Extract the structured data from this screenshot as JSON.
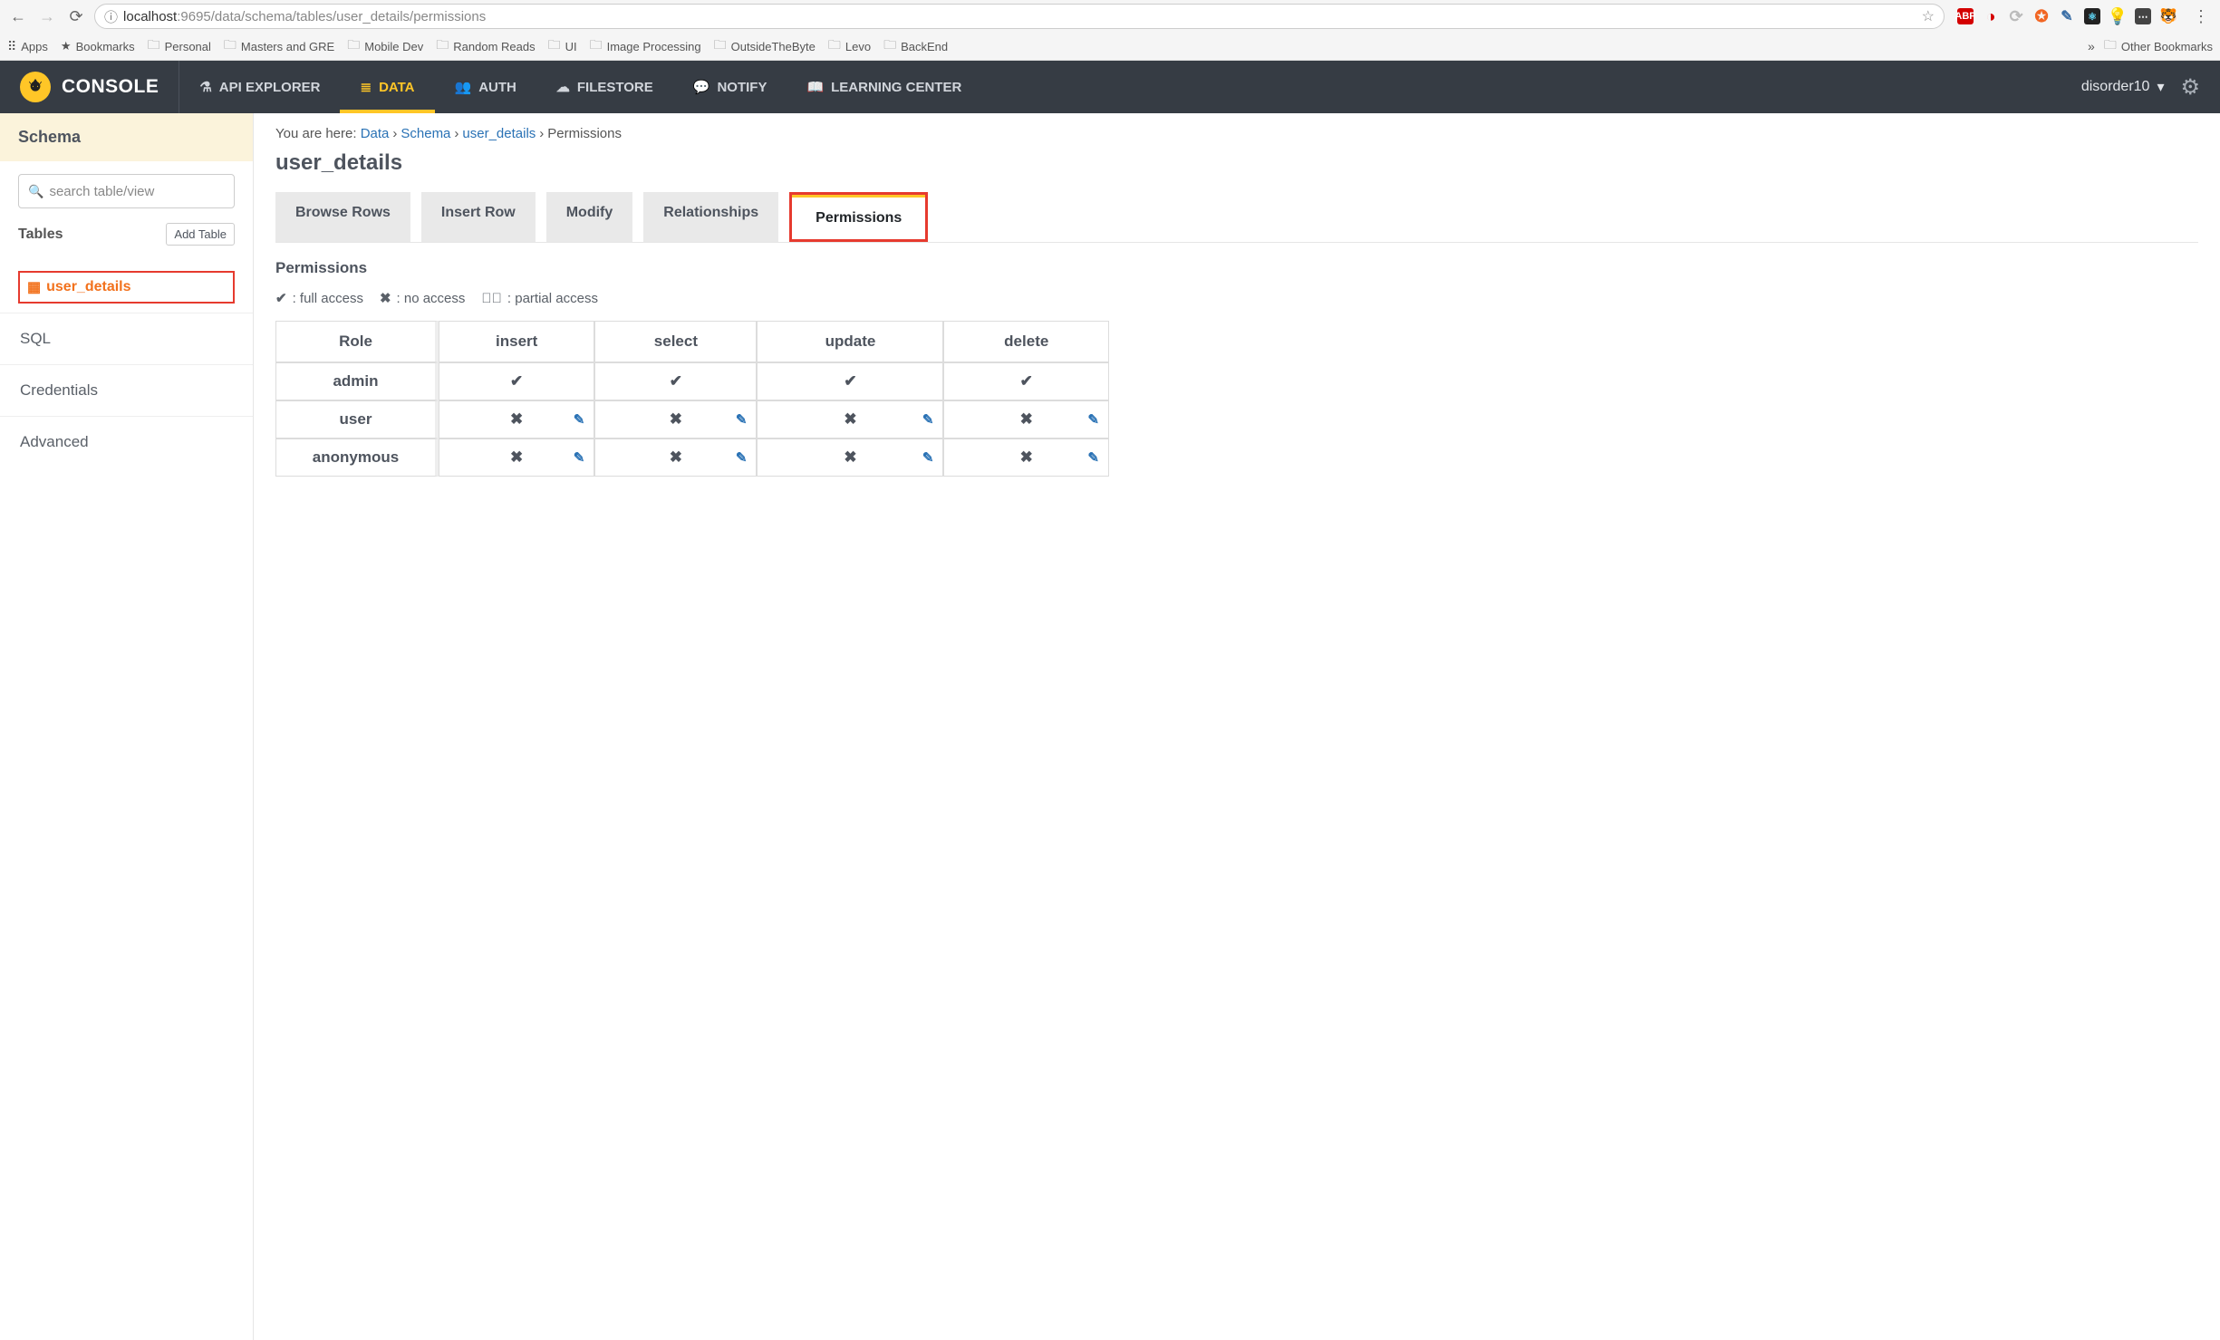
{
  "browser": {
    "url_host": "localhost",
    "url_port_path": ":9695/data/schema/tables/user_details/permissions",
    "bookmarks_bar": [
      {
        "label": "Apps",
        "kind": "apps"
      },
      {
        "label": "Bookmarks",
        "kind": "star"
      },
      {
        "label": "Personal",
        "kind": "folder"
      },
      {
        "label": "Masters and GRE",
        "kind": "folder"
      },
      {
        "label": "Mobile Dev",
        "kind": "folder"
      },
      {
        "label": "Random Reads",
        "kind": "folder"
      },
      {
        "label": "UI",
        "kind": "folder"
      },
      {
        "label": "Image Processing",
        "kind": "folder"
      },
      {
        "label": "OutsideTheByte",
        "kind": "folder"
      },
      {
        "label": "Levo",
        "kind": "folder"
      },
      {
        "label": "BackEnd",
        "kind": "folder"
      }
    ],
    "other_bookmarks_label": "Other Bookmarks"
  },
  "header": {
    "brand": "CONSOLE",
    "nav": [
      {
        "label": "API EXPLORER",
        "icon": "flask-icon",
        "active": false
      },
      {
        "label": "DATA",
        "icon": "database-icon",
        "active": true
      },
      {
        "label": "AUTH",
        "icon": "users-icon",
        "active": false
      },
      {
        "label": "FILESTORE",
        "icon": "cloud-icon",
        "active": false
      },
      {
        "label": "NOTIFY",
        "icon": "chat-icon",
        "active": false
      },
      {
        "label": "LEARNING CENTER",
        "icon": "book-icon",
        "active": false
      }
    ],
    "user": "disorder10"
  },
  "sidebar": {
    "title": "Schema",
    "search_placeholder": "search table/view",
    "tables_label": "Tables",
    "add_table_label": "Add Table",
    "tables": [
      {
        "name": "user_details",
        "selected": true
      }
    ],
    "links": [
      "SQL",
      "Credentials",
      "Advanced"
    ]
  },
  "breadcrumb": {
    "prefix": "You are here:",
    "items": [
      {
        "label": "Data",
        "link": true
      },
      {
        "label": "Schema",
        "link": true
      },
      {
        "label": "user_details",
        "link": true
      },
      {
        "label": "Permissions",
        "link": false
      }
    ]
  },
  "page": {
    "title": "user_details",
    "tabs": [
      {
        "label": "Browse Rows",
        "active": false
      },
      {
        "label": "Insert Row",
        "active": false
      },
      {
        "label": "Modify",
        "active": false
      },
      {
        "label": "Relationships",
        "active": false
      },
      {
        "label": "Permissions",
        "active": true
      }
    ],
    "section_title": "Permissions",
    "legend": {
      "full": ": full access",
      "none": ": no access",
      "partial": ": partial access"
    },
    "table": {
      "columns": [
        "Role",
        "insert",
        "select",
        "update",
        "delete"
      ],
      "rows": [
        {
          "role": "admin",
          "cells": [
            "full",
            "full",
            "full",
            "full"
          ],
          "editable": false
        },
        {
          "role": "user",
          "cells": [
            "none",
            "none",
            "none",
            "none"
          ],
          "editable": true
        },
        {
          "role": "anonymous",
          "cells": [
            "none",
            "none",
            "none",
            "none"
          ],
          "editable": true
        }
      ]
    }
  }
}
